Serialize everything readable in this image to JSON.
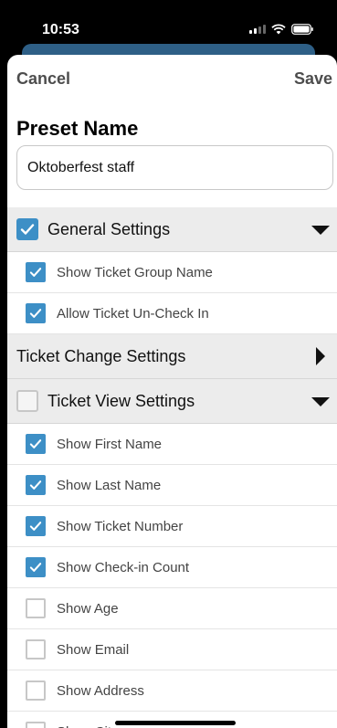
{
  "status_bar": {
    "time": "10:53"
  },
  "header": {
    "cancel_label": "Cancel",
    "save_label": "Save"
  },
  "preset": {
    "title": "Preset Name",
    "value": "Oktoberfest staff"
  },
  "sections": [
    {
      "label": "General Settings",
      "has_checkbox": true,
      "checked": true,
      "expanded": true,
      "items": [
        {
          "label": "Show Ticket Group Name",
          "checked": true
        },
        {
          "label": "Allow Ticket Un-Check In",
          "checked": true
        }
      ]
    },
    {
      "label": "Ticket Change Settings",
      "has_checkbox": false,
      "checked": false,
      "expanded": false,
      "items": []
    },
    {
      "label": "Ticket View Settings",
      "has_checkbox": true,
      "checked": false,
      "expanded": true,
      "items": [
        {
          "label": "Show First Name",
          "checked": true
        },
        {
          "label": "Show Last Name",
          "checked": true
        },
        {
          "label": "Show Ticket Number",
          "checked": true
        },
        {
          "label": "Show Check-in Count",
          "checked": true
        },
        {
          "label": "Show Age",
          "checked": false
        },
        {
          "label": "Show Email",
          "checked": false
        },
        {
          "label": "Show Address",
          "checked": false
        },
        {
          "label": "Show City",
          "checked": false
        }
      ]
    }
  ],
  "colors": {
    "accent": "#3d8fc6",
    "section_bg": "#ececec",
    "header_text": "#4d4d4d"
  }
}
